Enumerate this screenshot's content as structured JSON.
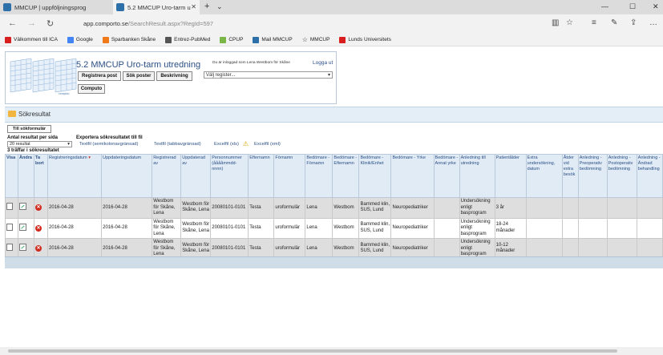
{
  "browser": {
    "tabs": [
      {
        "title": "MMCUP | uppföljningsprog",
        "active": false
      },
      {
        "title": "5.2 MMCUP Uro-tarm u",
        "active": true
      }
    ],
    "new_tab": "+",
    "tab_list": "⌄",
    "window_controls": {
      "minimize": "—",
      "maximize": "☐",
      "close": "✕"
    },
    "nav": {
      "back": "←",
      "forward": "→",
      "refresh": "↻"
    },
    "url_domain": "app.comporto.se",
    "url_path": "/SearchResult.aspx?RegId=597",
    "toolbar_icons": {
      "reading": "▥",
      "favorite": "☆",
      "hub": "≡",
      "notes": "✎",
      "share": "⇪",
      "more": "…"
    },
    "favorites": [
      {
        "label": "Välkommen till ICA",
        "color": "#d81e1e"
      },
      {
        "label": "Google",
        "color": "#4285f4"
      },
      {
        "label": "Sparbanken Skåne",
        "color": "#f07a1a"
      },
      {
        "label": "Entrez-PubMed",
        "color": "#555555"
      },
      {
        "label": "CPUP",
        "color": "#7ab648"
      },
      {
        "label": "Mail MMCUP",
        "color": "#2d6fa8"
      },
      {
        "label": "MMCUP",
        "color": "#999999"
      },
      {
        "label": "Lunds Universitets",
        "color": "#d81e1e"
      }
    ]
  },
  "app": {
    "title": "5.2 MMCUP Uro-tarm utredning",
    "logged_in": "Du är inloggad som Lena Westbom för Skåne",
    "logout": "Logga ut",
    "buttons": {
      "registrera": "Registrera post",
      "sok": "Sök poster",
      "beskrivning": "Beskrivning",
      "computo": "Computo"
    },
    "register_select": "Välj register...",
    "logo_caption": "computo"
  },
  "results": {
    "section_title": "Sökresultat",
    "back_button": "Till sökformulär",
    "per_page_label": "Antal resultat per sida",
    "per_page_value": "20 resultat",
    "export_label": "Exportera sökresultatet till fil",
    "export_links": [
      "Textfil (semikolonavgränsad)",
      "Textfil (tabbavgränsad)",
      "Excelfil (xls)",
      "Excelfil (xml)"
    ],
    "hits": "3 träffar i sökresultatet",
    "columns": [
      "Visa",
      "Ändra",
      "Ta bort",
      "Registreringsdatum",
      "Uppdateringsdatum",
      "Registrerad av",
      "Uppdaterad av",
      "Personnummer (ååååmmdd-nnnn)",
      "Efternamn",
      "Förnamn",
      "Bedömare - Förnamn",
      "Bedömare - Efternamn",
      "Bedömare - Klinik/Enhet",
      "Bedömare - Yrke",
      "Bedömare - Annat yrke",
      "Anledning till utredning",
      "Patientålder",
      "Extra undersökning, datum",
      "Åtder vid extra besök",
      "Anledning - Preoperativ bedömning",
      "Anledning - Postoperativ bedömning",
      "Anledning - Ändrad behandling"
    ],
    "rows": [
      {
        "reg_date": "2016-04-28",
        "upd_date": "2016-04-28",
        "reg_by": "Westbom för Skåne, Lena",
        "upd_by": "Westbom för Skåne, Lena",
        "pnr": "20080101-0101",
        "efternamn": "Testa",
        "fornamn": "uroformulär",
        "b_fornamn": "Lena",
        "b_efternamn": "Westbom",
        "b_klinik": "Barnmed klin, SUS, Lund",
        "b_yrke": "Neuropediatriker",
        "b_annat": "",
        "anledning": "Undersökning enligt basprogram",
        "alder": "3 år"
      },
      {
        "reg_date": "2016-04-28",
        "upd_date": "2016-04-28",
        "reg_by": "Westbom för Skåne, Lena",
        "upd_by": "Westbom för Skåne, Lena",
        "pnr": "20080101-0101",
        "efternamn": "Testa",
        "fornamn": "uroformulär",
        "b_fornamn": "Lena",
        "b_efternamn": "Westbom",
        "b_klinik": "Barnmed klin, SUS, Lund",
        "b_yrke": "Neuropediatriker",
        "b_annat": "",
        "anledning": "Undersökning enligt basprogram",
        "alder": "18-24 månader"
      },
      {
        "reg_date": "2016-04-28",
        "upd_date": "2016-04-28",
        "reg_by": "Westbom för Skåne, Lena",
        "upd_by": "Westbom för Skåne, Lena",
        "pnr": "20080101-0101",
        "efternamn": "Testa",
        "fornamn": "uroformulär",
        "b_fornamn": "Lena",
        "b_efternamn": "Westbom",
        "b_klinik": "Barnmed klin, SUS, Lund",
        "b_yrke": "Neuropediatriker",
        "b_annat": "",
        "anledning": "Undersökning enligt basprogram",
        "alder": "10-12 månader"
      }
    ]
  }
}
